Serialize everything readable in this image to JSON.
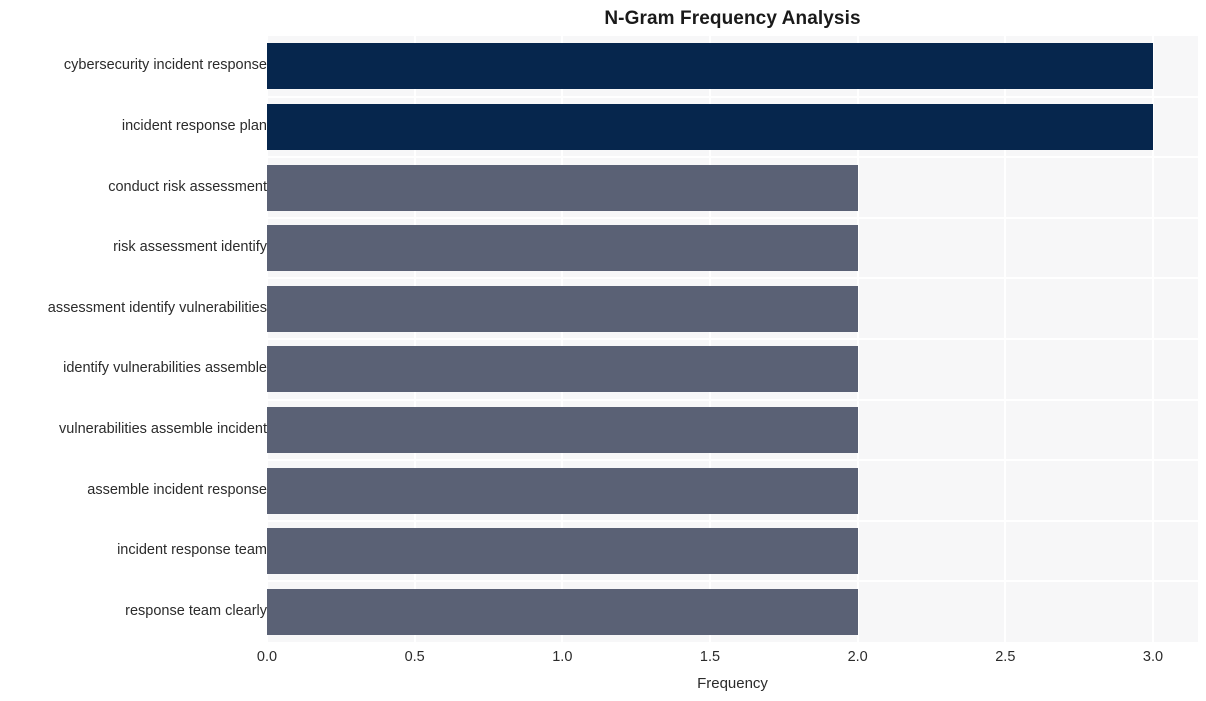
{
  "chart_data": {
    "type": "bar",
    "orientation": "horizontal",
    "title": "N-Gram Frequency Analysis",
    "xlabel": "Frequency",
    "ylabel": "",
    "xlim": [
      0.0,
      3.0
    ],
    "xticks": [
      "0.0",
      "0.5",
      "1.0",
      "1.5",
      "2.0",
      "2.5",
      "3.0"
    ],
    "xtick_values": [
      0.0,
      0.5,
      1.0,
      1.5,
      2.0,
      2.5,
      3.0
    ],
    "grid": true,
    "legend": "none",
    "categories": [
      "cybersecurity incident response",
      "incident response plan",
      "conduct risk assessment",
      "risk assessment identify",
      "assessment identify vulnerabilities",
      "identify vulnerabilities assemble",
      "vulnerabilities assemble incident",
      "assemble incident response",
      "incident response team",
      "response team clearly"
    ],
    "values": [
      3,
      3,
      2,
      2,
      2,
      2,
      2,
      2,
      2,
      2
    ],
    "bar_colors": [
      "#06264d",
      "#06264d",
      "#5a6175",
      "#5a6175",
      "#5a6175",
      "#5a6175",
      "#5a6175",
      "#5a6175",
      "#5a6175",
      "#5a6175"
    ]
  },
  "style": {
    "figure_background": "#ffffff",
    "plot_background": "#f7f7f8",
    "grid_color": "#ffffff",
    "text_color": "#2b2b2b",
    "title_color": "#1a1a1a",
    "accent_high": "#06264d",
    "accent_low": "#5a6175"
  }
}
